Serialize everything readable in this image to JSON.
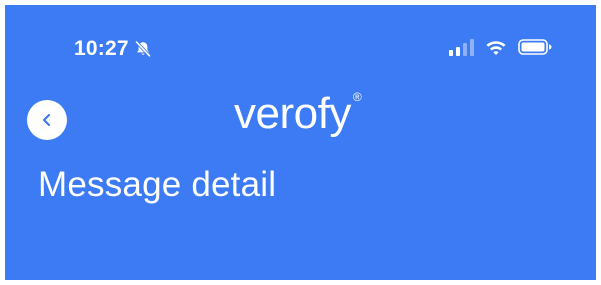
{
  "status_bar": {
    "time": "10:27",
    "bell_icon": "bell-slash-icon",
    "signal_icon": "cellular-signal-icon",
    "wifi_icon": "wifi-icon",
    "battery_icon": "battery-icon"
  },
  "nav": {
    "back_icon": "chevron-left-icon",
    "logo_text": "verofy",
    "logo_registered": "®"
  },
  "page": {
    "title": "Message detail"
  },
  "colors": {
    "background": "#3C7BF3",
    "foreground": "#FFFFFF",
    "back_chevron": "#3C7BF3",
    "signal_dim": "#8FB2F7"
  }
}
